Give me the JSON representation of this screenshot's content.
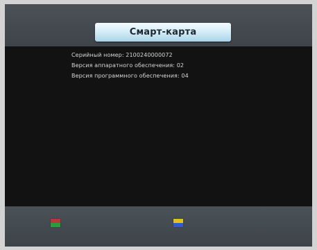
{
  "header": {
    "title": "Смарт-карта"
  },
  "info": {
    "serial_number": "Серийный номер: 2100240000072",
    "hardware_version": "Версия аппаратного обеспечения: 02",
    "software_version": "Версия программного обеспечения: 04"
  },
  "footer": {
    "left_button_colors": [
      "#b43a3a",
      "#2e9a3a"
    ],
    "right_button_colors": [
      "#e0c024",
      "#2a5ec8"
    ]
  },
  "colors": {
    "background": "#121212",
    "header_band": "#454b51",
    "title_pill": "#d6eef8"
  }
}
